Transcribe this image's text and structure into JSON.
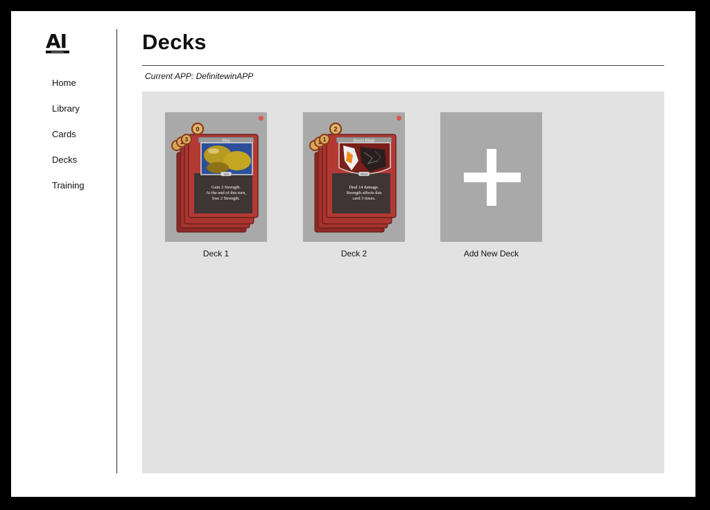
{
  "logo": {
    "text": "AI",
    "subtext": "Deckbuilding"
  },
  "nav": {
    "items": [
      {
        "label": "Home"
      },
      {
        "label": "Library"
      },
      {
        "label": "Cards"
      },
      {
        "label": "Decks"
      },
      {
        "label": "Training"
      }
    ]
  },
  "header": {
    "title": "Decks",
    "current_app": "Current APP: DefinitewinAPP"
  },
  "decks": [
    {
      "label": "Deck 1",
      "card": {
        "name": "Flex",
        "cost": "0",
        "stack_costs": [
          "3",
          "1"
        ],
        "type": "Skill",
        "art": "gold",
        "text_lines": [
          "Gain 2 Strength.",
          "At the end of this turn,",
          "lose 2 Strength."
        ]
      }
    },
    {
      "label": "Deck 2",
      "card": {
        "name": "Heavy Blade",
        "cost": "2",
        "stack_costs": [
          "1",
          "1"
        ],
        "type": "Attack",
        "art": "blade",
        "text_lines": [
          "Deal 14 damage.",
          "Strength affects this",
          "card 3 times."
        ]
      }
    }
  ],
  "add_deck": {
    "label": "Add New Deck",
    "icon": "plus-icon"
  },
  "colors": {
    "frame": "#000000",
    "panel": "#e2e2e2",
    "tile": "#a9a9a9",
    "card_red": "#b33a34",
    "status_dot": "#e0554d",
    "highlight": "#e8b94a"
  }
}
